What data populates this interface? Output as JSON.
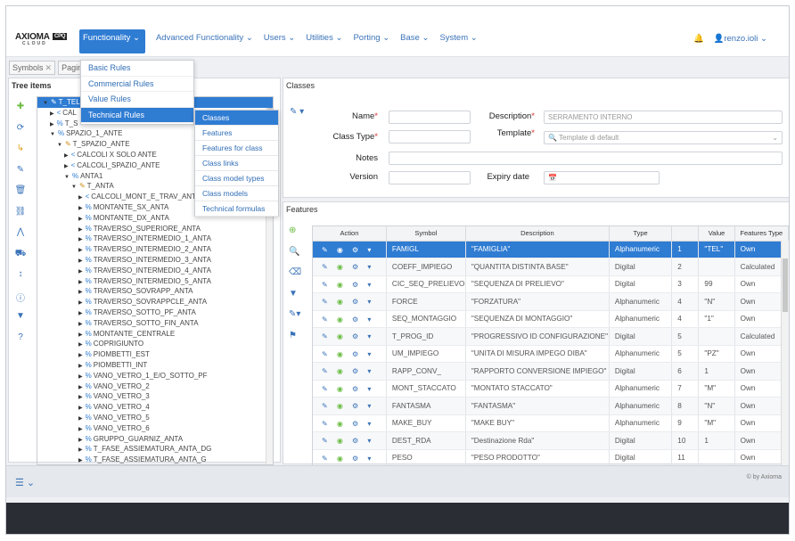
{
  "logo": {
    "brand": "AXIOMA",
    "sub": "CLOUD",
    "badge": "CPQ"
  },
  "nav": [
    {
      "label": "Functionality"
    },
    {
      "label": "Advanced Functionality"
    },
    {
      "label": "Users"
    },
    {
      "label": "Utilities"
    },
    {
      "label": "Porting"
    },
    {
      "label": "Base"
    },
    {
      "label": "System"
    }
  ],
  "user": {
    "name": "renzo.ioli"
  },
  "tabs": [
    {
      "label": "Symbols"
    },
    {
      "label": "Pagine"
    }
  ],
  "dropdown": [
    {
      "label": "Basic Rules"
    },
    {
      "label": "Commercial Rules"
    },
    {
      "label": "Value Rules"
    },
    {
      "label": "Technical Rules"
    }
  ],
  "submenu": [
    {
      "label": "Classes"
    },
    {
      "label": "Features"
    },
    {
      "label": "Features for class"
    },
    {
      "label": "Class links"
    },
    {
      "label": "Class model types"
    },
    {
      "label": "Class models"
    },
    {
      "label": "Technical formulas"
    }
  ],
  "tree": {
    "title": "Tree items",
    "rows": [
      {
        "t": "T_TEL",
        "d": 0,
        "ic": "wr",
        "a": "▼",
        "sel": true
      },
      {
        "t": "CAL",
        "d": 1,
        "ic": "sh",
        "a": "▶"
      },
      {
        "t": "T_S",
        "d": 1,
        "ic": "link",
        "a": "▶"
      },
      {
        "t": "SPAZIO_1_ANTE",
        "d": 1,
        "ic": "link",
        "a": "▼"
      },
      {
        "t": "T_SPAZIO_ANTE",
        "d": 2,
        "ic": "wr",
        "a": "▼"
      },
      {
        "t": "CALCOLI X SOLO ANTE",
        "d": 3,
        "ic": "sh",
        "a": "▶"
      },
      {
        "t": "CALCOLI_SPAZIO_ANTE",
        "d": 3,
        "ic": "sh",
        "a": "▶"
      },
      {
        "t": "ANTA1",
        "d": 3,
        "ic": "link",
        "a": "▼"
      },
      {
        "t": "T_ANTA",
        "d": 4,
        "ic": "wr",
        "a": "▼"
      },
      {
        "t": "CALCOLI_MONT_E_TRAV_ANT",
        "d": 5,
        "ic": "sh",
        "a": "▶"
      },
      {
        "t": "MONTANTE_SX_ANTA",
        "d": 5,
        "ic": "link",
        "a": "▶"
      },
      {
        "t": "MONTANTE_DX_ANTA",
        "d": 5,
        "ic": "link",
        "a": "▶"
      },
      {
        "t": "TRAVERSO_SUPERIORE_ANTA",
        "d": 5,
        "ic": "link",
        "a": "▶"
      },
      {
        "t": "TRAVERSO_INTERMEDIO_1_ANTA",
        "d": 5,
        "ic": "link",
        "a": "▶"
      },
      {
        "t": "TRAVERSO_INTERMEDIO_2_ANTA",
        "d": 5,
        "ic": "link",
        "a": "▶"
      },
      {
        "t": "TRAVERSO_INTERMEDIO_3_ANTA",
        "d": 5,
        "ic": "link",
        "a": "▶"
      },
      {
        "t": "TRAVERSO_INTERMEDIO_4_ANTA",
        "d": 5,
        "ic": "link",
        "a": "▶"
      },
      {
        "t": "TRAVERSO_INTERMEDIO_5_ANTA",
        "d": 5,
        "ic": "link",
        "a": "▶"
      },
      {
        "t": "TRAVERSO_SOVRAPP_ANTA",
        "d": 5,
        "ic": "link",
        "a": "▶"
      },
      {
        "t": "TRAVERSO_SOVRAPPCLE_ANTA",
        "d": 5,
        "ic": "link",
        "a": "▶"
      },
      {
        "t": "TRAVERSO_SOTTO_PF_ANTA",
        "d": 5,
        "ic": "link",
        "a": "▶"
      },
      {
        "t": "TRAVERSO_SOTTO_FIN_ANTA",
        "d": 5,
        "ic": "link",
        "a": "▶"
      },
      {
        "t": "MONTANTE_CENTRALE",
        "d": 5,
        "ic": "link",
        "a": "▶"
      },
      {
        "t": "COPRIGIUNTO",
        "d": 5,
        "ic": "link",
        "a": "▶"
      },
      {
        "t": "PIOMBETTI_EST",
        "d": 5,
        "ic": "link",
        "a": "▶"
      },
      {
        "t": "PIOMBETTI_INT",
        "d": 5,
        "ic": "link",
        "a": "▶"
      },
      {
        "t": "VANO_VETRO_1_E/O_SOTTO_PF",
        "d": 5,
        "ic": "link",
        "a": "▶"
      },
      {
        "t": "VANO_VETRO_2",
        "d": 5,
        "ic": "link",
        "a": "▶"
      },
      {
        "t": "VANO_VETRO_3",
        "d": 5,
        "ic": "link",
        "a": "▶"
      },
      {
        "t": "VANO_VETRO_4",
        "d": 5,
        "ic": "link",
        "a": "▶"
      },
      {
        "t": "VANO_VETRO_5",
        "d": 5,
        "ic": "link",
        "a": "▶"
      },
      {
        "t": "VANO_VETRO_6",
        "d": 5,
        "ic": "link",
        "a": "▶"
      },
      {
        "t": "GRUPPO_GUARNIZ_ANTA",
        "d": 5,
        "ic": "link",
        "a": "▶"
      },
      {
        "t": "T_FASE_ASSIEMATURA_ANTA_DG",
        "d": 5,
        "ic": "link",
        "a": "▶"
      },
      {
        "t": "T_FASE_ASSIEMATURA_ANTA_G",
        "d": 5,
        "ic": "link",
        "a": "▶"
      }
    ]
  },
  "classes": {
    "title": "Classes",
    "name_label": "Name",
    "description_label": "Description",
    "description_value": "SERRAMENTO INTERNO",
    "classtype_label": "Class Type",
    "template_label": "Template",
    "template_placeholder": "Template di default",
    "notes_label": "Notes",
    "version_label": "Version",
    "expiry_label": "Expiry date"
  },
  "features": {
    "title": "Features",
    "columns": [
      "Action",
      "Symbol",
      "Description",
      "Type",
      "",
      "Value",
      "Features Type"
    ],
    "rows": [
      [
        "FAMIGL",
        "\"FAMIGLIA\"",
        "Alphanumeric",
        "1",
        "\"TEL\"",
        "Own"
      ],
      [
        "COEFF_IMPIEGO",
        "\"QUANTITA DISTINTA BASE\"",
        "Digital",
        "2",
        "",
        "Calculated"
      ],
      [
        "CIC_SEQ_PRELIEVO",
        "\"SEQUENZA DI PRELIEVO\"",
        "Digital",
        "3",
        "99",
        "Own"
      ],
      [
        "FORCE",
        "\"FORZATURA\"",
        "Alphanumeric",
        "4",
        "\"N\"",
        "Own"
      ],
      [
        "SEQ_MONTAGGIO",
        "\"SEQUENZA DI MONTAGGIO\"",
        "Alphanumeric",
        "4",
        "\"1\"",
        "Own"
      ],
      [
        "T_PROG_ID",
        "\"PROGRESSIVO ID CONFIGURAZIONE\"",
        "Digital",
        "5",
        "",
        "Calculated"
      ],
      [
        "UM_IMPIEGO",
        "\"UNITA DI MISURA IMPEGO DIBA\"",
        "Alphanumeric",
        "5",
        "\"PZ\"",
        "Own"
      ],
      [
        "RAPP_CONV_",
        "\"RAPPORTO CONVERSIONE IMPIEGO\"",
        "Digital",
        "6",
        "1",
        "Own"
      ],
      [
        "MONT_STACCATO",
        "\"MONTATO STACCATO\"",
        "Alphanumeric",
        "7",
        "\"M\"",
        "Own"
      ],
      [
        "FANTASMA",
        "\"FANTASMA\"",
        "Alphanumeric",
        "8",
        "\"N\"",
        "Own"
      ],
      [
        "MAKE_BUY",
        "\"MAKE BUY\"",
        "Alphanumeric",
        "9",
        "\"M\"",
        "Own"
      ],
      [
        "DEST_RDA",
        "\"Destinazione Rda\"",
        "Digital",
        "10",
        "1",
        "Own"
      ],
      [
        "PESO",
        "\"PESO PRODOTTO\"",
        "Digital",
        "11",
        "",
        "Own"
      ]
    ]
  },
  "footer": {
    "by": "© by Axioma"
  }
}
